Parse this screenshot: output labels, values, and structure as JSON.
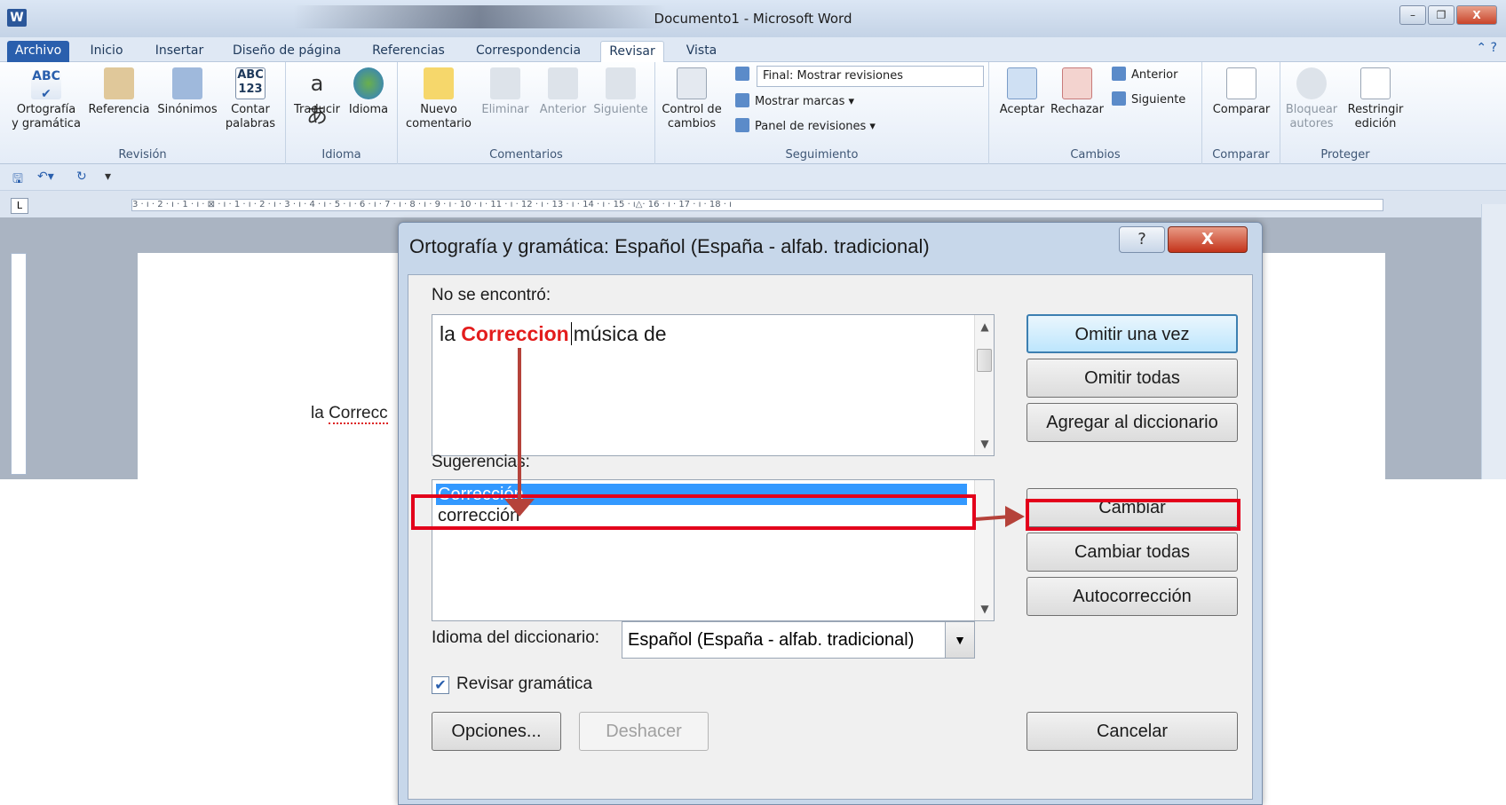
{
  "window": {
    "title": "Documento1 - Microsoft Word",
    "logo": "W",
    "minimize": "–",
    "restore": "❐",
    "close": "X"
  },
  "tabs": [
    "Archivo",
    "Inicio",
    "Insertar",
    "Diseño de página",
    "Referencias",
    "Correspondencia",
    "Revisar",
    "Vista"
  ],
  "ribbon": {
    "revision": {
      "label": "Revisión",
      "spell": "Ortografía\ny gramática",
      "research": "Referencia",
      "thesaurus": "Sinónimos",
      "wordcount": "Contar\npalabras"
    },
    "idioma": {
      "label": "Idioma",
      "translate": "Traducir",
      "language": "Idioma"
    },
    "comentarios": {
      "label": "Comentarios",
      "new": "Nuevo\ncomentario",
      "delete": "Eliminar",
      "prev": "Anterior",
      "next": "Siguiente"
    },
    "seguimiento": {
      "label": "Seguimiento",
      "track": "Control de\ncambios",
      "display": "Final: Mostrar revisiones",
      "markup": "Mostrar marcas",
      "pane": "Panel de revisiones"
    },
    "cambios": {
      "label": "Cambios",
      "accept": "Aceptar",
      "reject": "Rechazar",
      "prev": "Anterior",
      "next": "Siguiente"
    },
    "comparar": {
      "label": "Comparar",
      "compare": "Comparar"
    },
    "proteger": {
      "label": "Proteger",
      "block": "Bloquear\nautores",
      "restrict": "Restringir\nedición"
    }
  },
  "ruler": {
    "marks": "3 · ı · 2 · ı · 1 · ı · ⊠ · ı · 1 · ı · 2 · ı · 3 · ı · 4 · ı · 5 · ı · 6 · ı · 7 · ı · 8 · ı · 9 · ı · 10 · ı · 11 · ı · 12 · ı · 13 · ı · 14 · ı · 15 · ı△· 16 · ı · 17 · ı · 18 · ı",
    "tab": "L"
  },
  "document": {
    "text_start": "la ",
    "text_misspelled": "Correcc"
  },
  "dialog": {
    "title": "Ortografía y gramática: Español (España - alfab. tradicional)",
    "help": "?",
    "close": "X",
    "not_found_label": "No se encontró:",
    "not_found_before": "la ",
    "not_found_error": "Correccion",
    "not_found_after": "música de",
    "suggestions_label": "Sugerencias:",
    "suggestions": [
      "Corrección",
      "corrección"
    ],
    "buttons": {
      "ignore_once": "Omitir una vez",
      "ignore_all": "Omitir todas",
      "add_dict": "Agregar al diccionario",
      "change": "Cambiar",
      "change_all": "Cambiar todas",
      "autocorrect": "Autocorrección",
      "options": "Opciones...",
      "undo": "Deshacer",
      "cancel": "Cancelar"
    },
    "dict_lang_label": "Idioma del diccionario:",
    "dict_lang_value": "Español (España - alfab. tradicional)",
    "check_grammar_label": "Revisar gramática",
    "check_grammar_checked": true
  },
  "colors": {
    "annotation": "#e3001b",
    "arrow": "#b5423a",
    "selection": "#3399ff",
    "error": "#e31c1c"
  }
}
